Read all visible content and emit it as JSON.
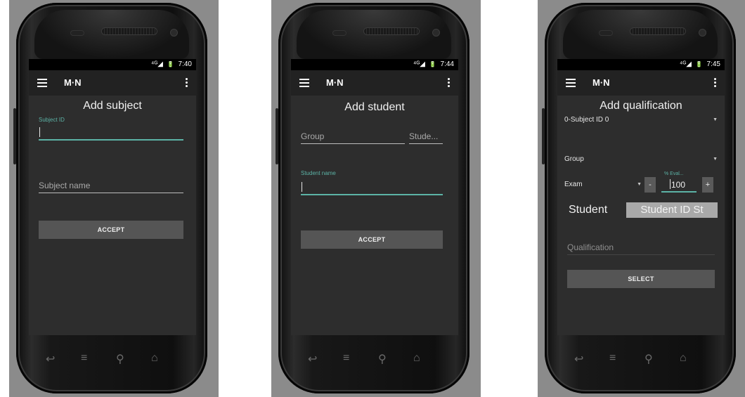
{
  "status": {
    "time1": "7:40",
    "time2": "7:44",
    "time3": "7:45",
    "signal": "⁴ᴳ◢",
    "battery": "🔋"
  },
  "app": {
    "title": "M·N"
  },
  "nav_icons": {
    "back": "↩",
    "home_menu": "≡",
    "search": "⚲",
    "home": "⌂"
  },
  "screen1": {
    "title": "Add subject",
    "subject_id_label": "Subject ID",
    "subject_name_placeholder": "Subject name",
    "accept_label": "ACCEPT"
  },
  "screen2": {
    "title": "Add student",
    "group_placeholder": "Group",
    "student_placeholder": "Stude...",
    "student_name_label": "Student name",
    "accept_label": "ACCEPT"
  },
  "screen3": {
    "title": "Add qualification",
    "subject_select": "0-Subject ID 0",
    "group_select": "Group",
    "exam_select": "Exam",
    "minus_label": "-",
    "plus_label": "+",
    "eval_label": "% Eval...",
    "eval_value": "100",
    "student_label": "Student",
    "student_id_value": "Student ID St",
    "qualification_placeholder": "Qualification",
    "select_label": "SELECT"
  }
}
